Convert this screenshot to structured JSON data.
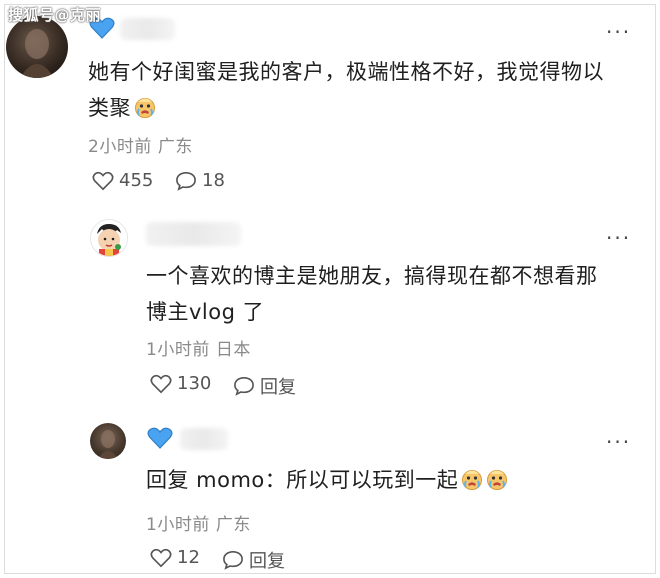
{
  "watermark": "搜狐号@克丽",
  "comments": [
    {
      "text_line1": "她有个好闺蜜是我的客户，极端性格不好，我觉得物以",
      "text_line2": "类聚",
      "time": "2小时前",
      "location": "广东",
      "like_count": "455",
      "comment_count": "18",
      "badge_color": "#4aa3f0"
    },
    {
      "text_line1": "一个喜欢的博主是她朋友，搞得现在都不想看那",
      "text_line2": "博主vlog 了",
      "time": "1小时前",
      "location": "日本",
      "like_count": "130",
      "reply_label": "回复"
    },
    {
      "text": "回复 momo：所以可以玩到一起",
      "time": "1小时前",
      "location": "广东",
      "like_count": "12",
      "reply_label": "回复",
      "badge_color": "#4aa3f0"
    }
  ],
  "more_glyph": "···"
}
